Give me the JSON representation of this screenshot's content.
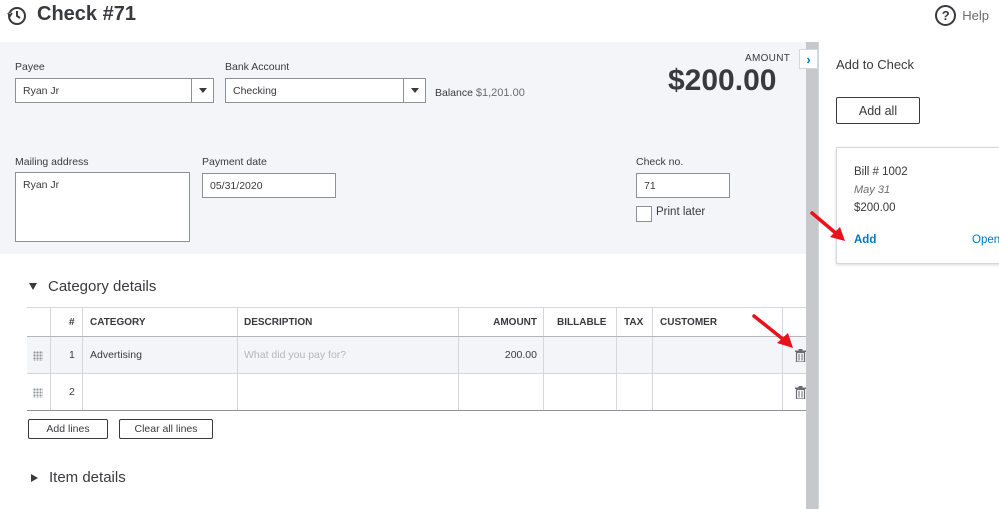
{
  "header": {
    "title": "Check #71",
    "help_label": "Help",
    "help_glyph": "?"
  },
  "form": {
    "payee_label": "Payee",
    "payee_value": "Ryan Jr",
    "bank_label": "Bank Account",
    "bank_value": "Checking",
    "balance_label": "Balance",
    "balance_value": "$1,201.00",
    "amount_label": "AMOUNT",
    "amount_value": "$200.00",
    "mailing_label": "Mailing address",
    "mailing_value": "Ryan Jr",
    "payment_date_label": "Payment date",
    "payment_date_value": "05/31/2020",
    "check_no_label": "Check no.",
    "check_no_value": "71",
    "print_later_label": "Print later"
  },
  "category_section": {
    "title": "Category details",
    "columns": {
      "num": "#",
      "category": "CATEGORY",
      "description": "DESCRIPTION",
      "amount": "AMOUNT",
      "billable": "BILLABLE",
      "tax": "TAX",
      "customer": "CUSTOMER"
    },
    "rows": [
      {
        "num": "1",
        "category": "Advertising",
        "description_placeholder": "What did you pay for?",
        "amount": "200.00"
      },
      {
        "num": "2",
        "category": "",
        "description_placeholder": "",
        "amount": ""
      }
    ],
    "add_lines_label": "Add lines",
    "clear_lines_label": "Clear all lines"
  },
  "item_section": {
    "title": "Item details"
  },
  "side_panel": {
    "collapse_glyph": "›",
    "title": "Add to Check",
    "add_all_label": "Add all",
    "card": {
      "title": "Bill # 1002",
      "date": "May 31",
      "amount": "$200.00",
      "add_label": "Add",
      "open_label": "Open"
    }
  },
  "colors": {
    "accent": "#0077c5",
    "arrow": "#e8121b",
    "form_bg": "#f4f5f8"
  }
}
